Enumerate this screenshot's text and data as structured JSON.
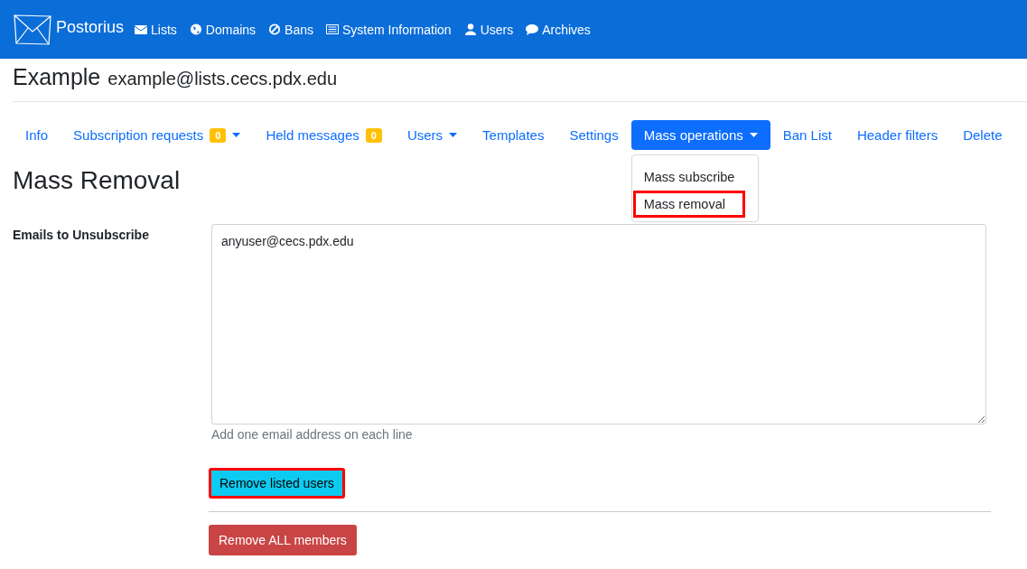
{
  "navbar": {
    "brand": "Postorius",
    "links": [
      {
        "label": "Lists"
      },
      {
        "label": "Domains"
      },
      {
        "label": "Bans"
      },
      {
        "label": "System Information"
      },
      {
        "label": "Users"
      },
      {
        "label": "Archives"
      }
    ]
  },
  "list_header": {
    "name": "Example",
    "address": "example@lists.cecs.pdx.edu"
  },
  "tabs": [
    {
      "label": "Info",
      "selected": false
    },
    {
      "label": "Subscription requests",
      "selected": false,
      "badge": "0",
      "dropdown": true
    },
    {
      "label": "Held messages",
      "selected": false,
      "badge": "0"
    },
    {
      "label": "Users",
      "selected": false,
      "dropdown": true
    },
    {
      "label": "Templates",
      "selected": false
    },
    {
      "label": "Settings",
      "selected": false
    },
    {
      "label": "Mass operations",
      "selected": true,
      "dropdown": true,
      "menu": [
        {
          "label": "Mass subscribe",
          "highlighted": false
        },
        {
          "label": "Mass removal",
          "highlighted": true
        }
      ]
    },
    {
      "label": "Ban List",
      "selected": false
    },
    {
      "label": "Header filters",
      "selected": false
    },
    {
      "label": "Delete",
      "selected": false
    }
  ],
  "page_title": "Mass Removal",
  "form": {
    "label": "Emails to Unsubscribe",
    "value": "anyuser@cecs.pdx.edu",
    "help": "Add one email address on each line"
  },
  "buttons": [
    {
      "label": "Remove listed users",
      "kind": "info",
      "highlighted": true
    },
    {
      "label": "Remove ALL members",
      "kind": "danger",
      "highlighted": false
    }
  ]
}
